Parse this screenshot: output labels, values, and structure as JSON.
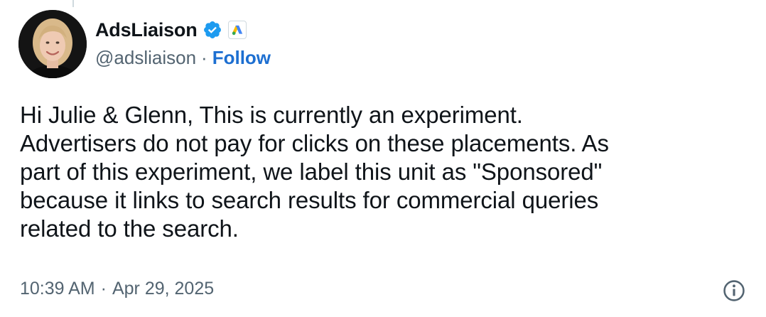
{
  "author": {
    "display_name": "AdsLiaison",
    "handle": "@adsliaison",
    "separator": "·",
    "follow_label": "Follow",
    "verified_badge": "verified-badge-icon",
    "affiliation_badge": "google-ads-logo-icon"
  },
  "tweet": {
    "text": "Hi Julie & Glenn, This is currently an experiment.\nAdvertisers do not pay for clicks on these placements. As\npart of this experiment, we label this unit as \"Sponsored\"\nbecause it links to search results for commercial queries\nrelated to the search."
  },
  "meta": {
    "time": "10:39 AM",
    "separator": "·",
    "date": "Apr 29, 2025"
  },
  "colors": {
    "text_primary": "#0f1419",
    "text_secondary": "#536471",
    "follow_blue": "#1d6fd1",
    "verified_blue": "#1d9bf0"
  }
}
